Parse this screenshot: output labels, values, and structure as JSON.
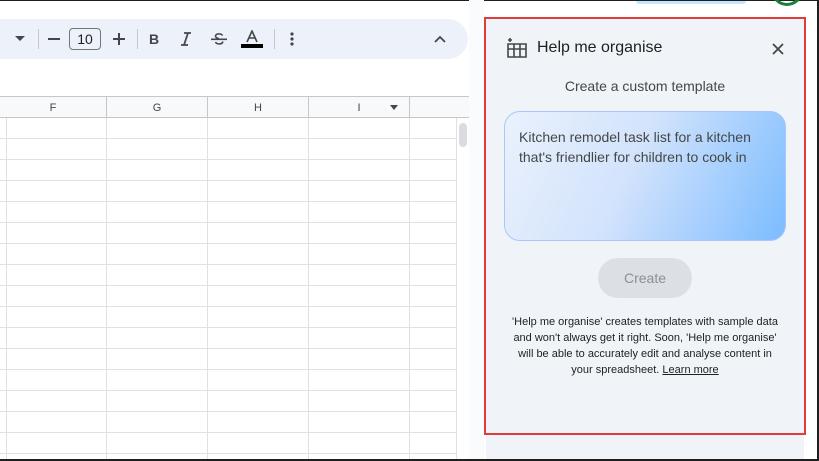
{
  "toolbar": {
    "font_size": "10",
    "font_color": "#000000"
  },
  "grid": {
    "columns": [
      "F",
      "G",
      "H",
      "I"
    ]
  },
  "panel": {
    "title": "Help me organise",
    "subtitle": "Create a custom template",
    "prompt_value": "Kitchen remodel task list for a kitchen that's friendlier for children to cook in",
    "create_label": "Create",
    "disclaimer": "'Help me organise' creates templates with sample data and won't always get it right. Soon, 'Help me organise' will be able to accurately edit and analyse content in your spreadsheet.",
    "learn_more": "Learn more"
  },
  "colors": {
    "highlight_border": "#e03c3c",
    "panel_bg": "#f0f4f9",
    "toolbar_bg": "#edf2fa"
  }
}
